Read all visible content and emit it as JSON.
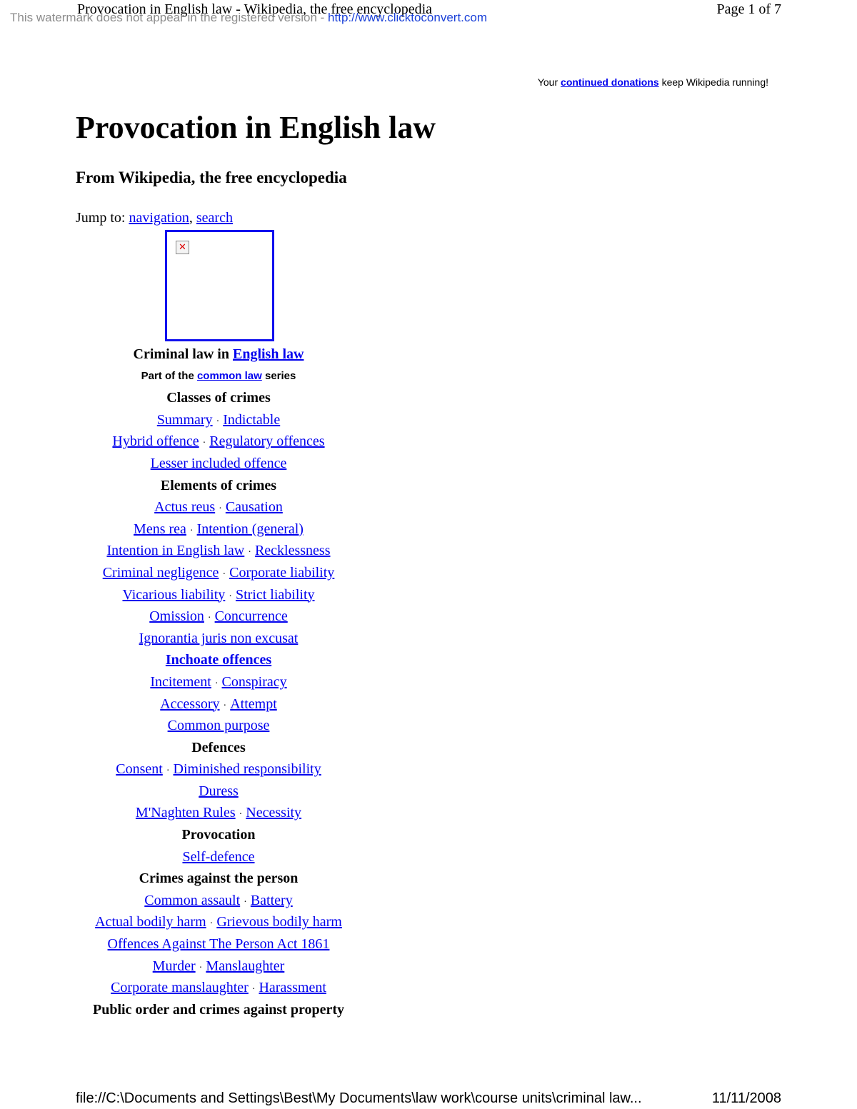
{
  "header": {
    "title": "Provocation in English law - Wikipedia, the free encyclopedia",
    "page": "Page 1 of 7"
  },
  "watermark": {
    "text": "This watermark does not appear in the registered version - ",
    "url": "http://www.clicktoconvert.com"
  },
  "donation": {
    "prefix": "Your ",
    "link": "continued donations",
    "suffix": " keep Wikipedia running!"
  },
  "article": {
    "title": "Provocation in English law",
    "subtitle": "From Wikipedia, the free encyclopedia",
    "jump_label": "Jump to: ",
    "jump_nav": "navigation",
    "jump_sep": ", ",
    "jump_search": "search"
  },
  "infobox": {
    "title_prefix": "Criminal law in ",
    "title_link": "English law",
    "series_prefix": "Part of the ",
    "series_link": "common law",
    "series_suffix": " series",
    "sections": {
      "classes": "Classes of crimes",
      "elements": "Elements of crimes",
      "inchoate": "Inchoate offences",
      "defences": "Defences",
      "provocation": "Provocation",
      "person": "Crimes against the person",
      "public": "Public order and crimes against property"
    },
    "links": {
      "summary": "Summary",
      "indictable": "Indictable",
      "hybrid": "Hybrid offence",
      "regulatory": "Regulatory offences",
      "lesser": "Lesser included offence",
      "actus": "Actus reus",
      "causation": "Causation",
      "mens": "Mens rea",
      "intention_general": "Intention (general)",
      "intention_english": "Intention in English law",
      "recklessness": "Recklessness",
      "criminal_negligence": "Criminal negligence",
      "corporate_liability": "Corporate liability",
      "vicarious": "Vicarious liability",
      "strict": "Strict liability",
      "omission": "Omission",
      "concurrence": "Concurrence",
      "ignorantia": "Ignorantia juris non excusat",
      "incitement": "Incitement",
      "conspiracy": "Conspiracy",
      "accessory": "Accessory",
      "attempt": "Attempt",
      "common_purpose": "Common purpose",
      "consent": "Consent",
      "diminished": "Diminished responsibility",
      "duress": "Duress",
      "mnaghten": "M'Naghten Rules",
      "necessity": "Necessity",
      "self_defence": "Self-defence",
      "common_assault": "Common assault",
      "battery": "Battery",
      "abh": "Actual bodily harm",
      "gbh": "Grievous bodily harm",
      "oapa": "Offences Against The Person Act 1861",
      "murder": "Murder",
      "manslaughter": "Manslaughter",
      "corporate_manslaughter": "Corporate manslaughter",
      "harassment": "Harassment"
    },
    "separator": "·"
  },
  "footer": {
    "path": "file://C:\\Documents and Settings\\Best\\My Documents\\law work\\course units\\criminal law...",
    "date": "11/11/2008"
  }
}
